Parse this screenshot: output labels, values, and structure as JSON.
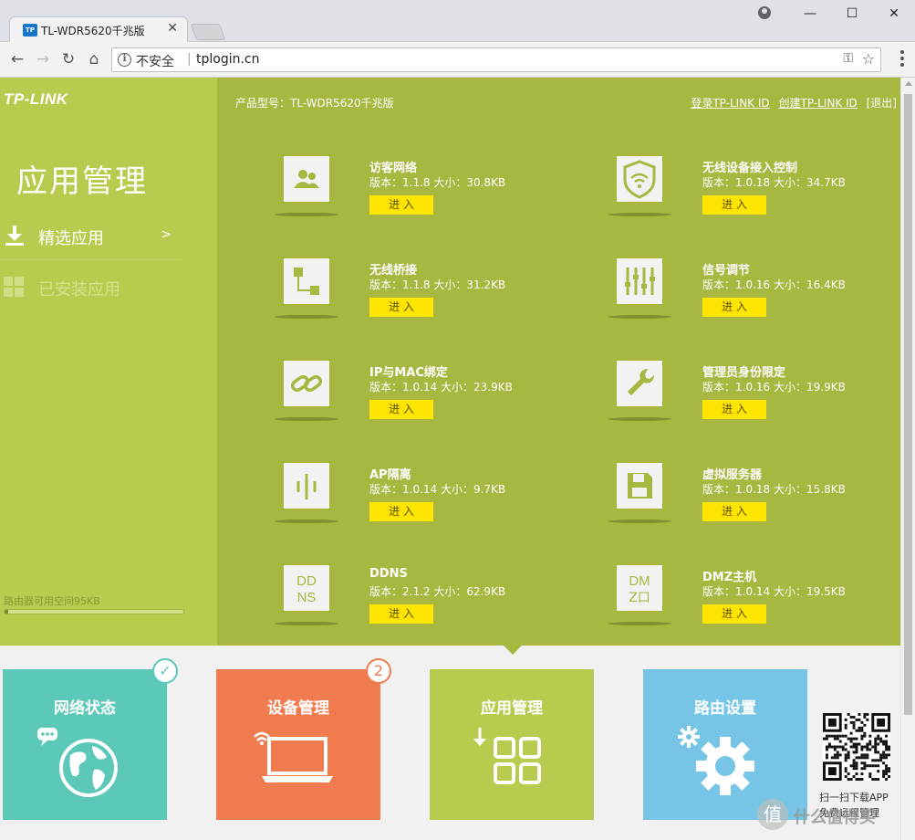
{
  "browser": {
    "tab_title": "TL-WDR5620千兆版",
    "tab_favicon": "TP",
    "security_label": "不安全",
    "url": "tplogin.cn",
    "window": {
      "minimize": "—",
      "maximize": "☐",
      "close": "✕"
    }
  },
  "sidebar": {
    "logo": "TP-LINK",
    "title": "应用管理",
    "items": [
      {
        "label": "精选应用",
        "chevron": ">",
        "icon": "download-icon"
      },
      {
        "label": "已安装应用",
        "icon": "grid-icon"
      }
    ],
    "storage_label": "路由器可用空间95KB",
    "storage_fraction": 0.02
  },
  "main": {
    "model": "产品型号：TL-WDR5620千兆版",
    "links": {
      "login": "登录TP-LINK ID",
      "create": "创建TP-LINK ID",
      "logout": "[退出]"
    },
    "apps": [
      {
        "name": "访客网络",
        "meta": "版本：1.1.8  大小：30.8KB",
        "button": "进 入",
        "icon": "guest-network-icon"
      },
      {
        "name": "无线设备接入控制",
        "meta": "版本：1.0.18  大小：34.7KB",
        "button": "进 入",
        "icon": "wireless-access-control-icon"
      },
      {
        "name": "无线桥接",
        "meta": "版本：1.1.8  大小：31.2KB",
        "button": "进 入",
        "icon": "wireless-bridge-icon"
      },
      {
        "name": "信号调节",
        "meta": "版本：1.0.16  大小：16.4KB",
        "button": "进 入",
        "icon": "signal-adjust-icon"
      },
      {
        "name": "IP与MAC绑定",
        "meta": "版本：1.0.14  大小：23.9KB",
        "button": "进 入",
        "icon": "link-icon"
      },
      {
        "name": "管理员身份限定",
        "meta": "版本：1.0.16  大小：19.9KB",
        "button": "进 入",
        "icon": "wrench-icon"
      },
      {
        "name": "AP隔离",
        "meta": "版本：1.0.14  大小：9.7KB",
        "button": "进 入",
        "icon": "ap-isolation-icon"
      },
      {
        "name": "虚拟服务器",
        "meta": "版本：1.0.18  大小：15.8KB",
        "button": "进 入",
        "icon": "server-icon"
      },
      {
        "name": "DDNS",
        "meta": "版本：2.1.2  大小：62.9KB",
        "button": "进 入",
        "icon": "ddns-icon",
        "glyph": [
          "DD",
          "NS"
        ]
      },
      {
        "name": "DMZ主机",
        "meta": "版本：1.0.14  大小：19.5KB",
        "button": "进 入",
        "icon": "dmz-icon",
        "glyph": [
          "DM",
          "Z口"
        ]
      }
    ]
  },
  "tiles": {
    "status": {
      "title": "网络状态",
      "badge": "✓"
    },
    "device": {
      "title": "设备管理",
      "badge": "2"
    },
    "apps": {
      "title": "应用管理"
    },
    "router": {
      "title": "路由设置"
    }
  },
  "qr": {
    "label": "扫一扫下载APP",
    "sub": "免费远程管理"
  },
  "watermark": {
    "mark": "值",
    "text": "什么值得买"
  },
  "colors": {
    "sidebar": "#b9cb4e",
    "main": "#a7b73f",
    "button": "#ffe400",
    "status": "#5cc9b8",
    "device": "#f07b4f",
    "router": "#76c5e6"
  }
}
